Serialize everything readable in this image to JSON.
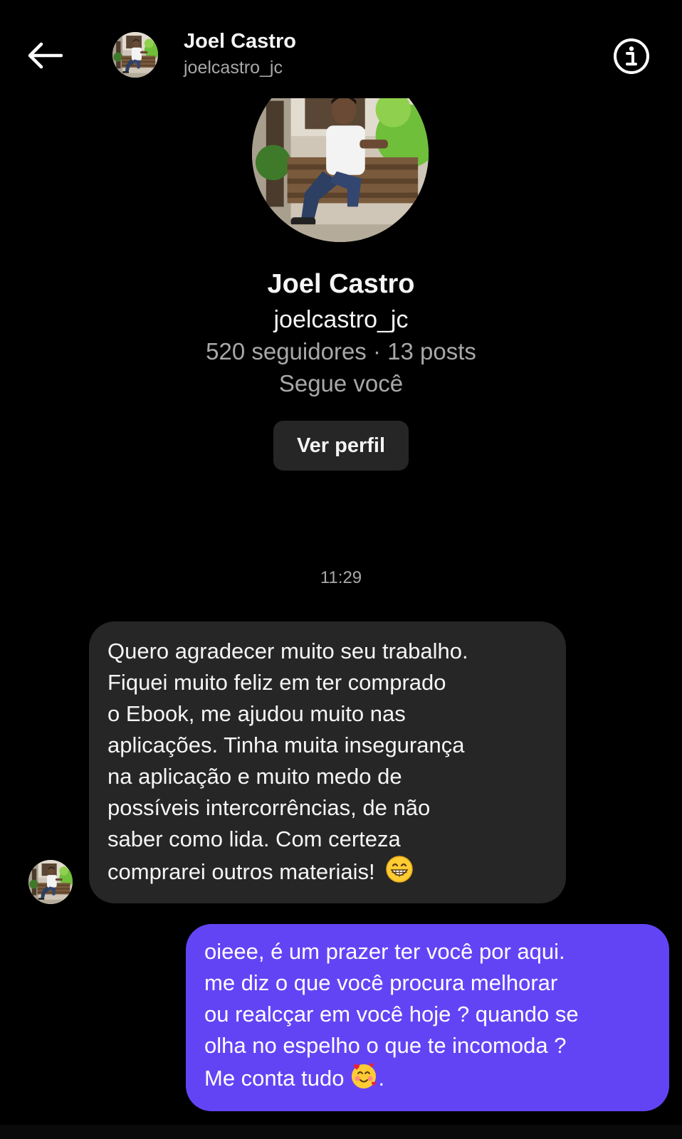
{
  "header": {
    "name": "Joel Castro",
    "username": "joelcastro_jc",
    "back_icon": "arrow-left-icon",
    "info_icon": "info-circle-icon"
  },
  "profile": {
    "name": "Joel Castro",
    "username": "joelcastro_jc",
    "stats": "520 seguidores · 13 posts",
    "follows_you": "Segue você",
    "view_profile_label": "Ver perfil"
  },
  "conversation": {
    "timestamp": "11:29",
    "incoming_message": {
      "lines": [
        "Quero agradecer muito seu trabalho.",
        "Fiquei muito feliz em ter comprado",
        "o Ebook, me ajudou muito nas",
        "aplicações. Tinha muita insegurança",
        "na aplicação e muito medo de",
        "possíveis intercorrências, de não",
        "saber como lida. Com certeza",
        "comprarei outros materiais!"
      ],
      "emoji": "grinning-face-emoji"
    },
    "outgoing_message": {
      "lines": [
        "oieee, é um prazer ter você por aqui.",
        "me diz o que você procura melhorar",
        "ou realcçar em você hoje ? quando se",
        "olha no espelho o que te incomoda ?",
        "Me conta tudo"
      ],
      "line_end": ".",
      "emoji": "smiling-face-with-hearts-emoji"
    }
  },
  "colors": {
    "background": "#000000",
    "incoming_bubble": "#262626",
    "outgoing_bubble": "#6344f5",
    "secondary_text": "#a8a8a8"
  }
}
